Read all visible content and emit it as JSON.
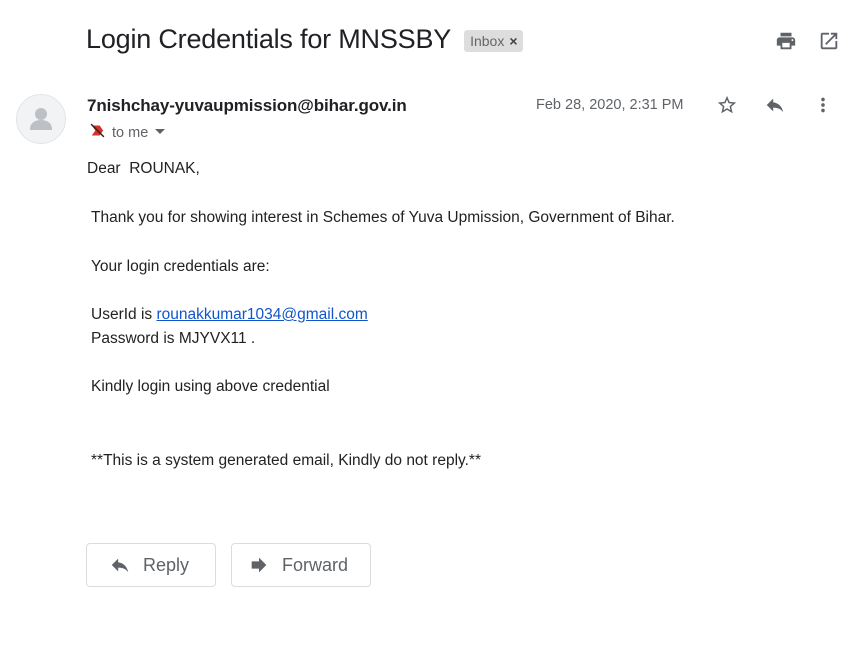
{
  "email": {
    "subject": "Login Credentials for MNSSBY",
    "label": "Inbox",
    "label_remove": "×",
    "sender": "7nishchay-yuvaupmission@bihar.gov.in",
    "recipient_text": "to me",
    "date": "Feb 28, 2020, 2:31 PM",
    "body": {
      "greeting": "Dear  ROUNAK,",
      "line1": "Thank you for showing interest in Schemes of Yuva Upmission, Government of Bihar.",
      "line2": "Your login credentials are:",
      "userid_prefix": "UserId is ",
      "userid_link": "rounakkumar1034@gmail.com",
      "password_line": "Password is MJYVX11 .",
      "line3": "Kindly login using above credential",
      "footer": "**This is a system generated email, Kindly do not reply.**"
    }
  },
  "actions": {
    "reply_label": "Reply",
    "forward_label": "Forward"
  },
  "icons": {
    "print": "print-icon",
    "open_new_window": "open-in-new-window-icon",
    "star": "star-icon",
    "reply": "reply-icon",
    "more": "more-vertical-icon",
    "not_important": "label-important-off-icon",
    "dropdown": "caret-down-icon",
    "forward": "forward-icon",
    "avatar": "default-avatar-icon"
  },
  "colors": {
    "link": "#1155cc",
    "icon": "#5f6368",
    "chip_bg": "#dddddd",
    "not_important_icon": "#d93025"
  }
}
